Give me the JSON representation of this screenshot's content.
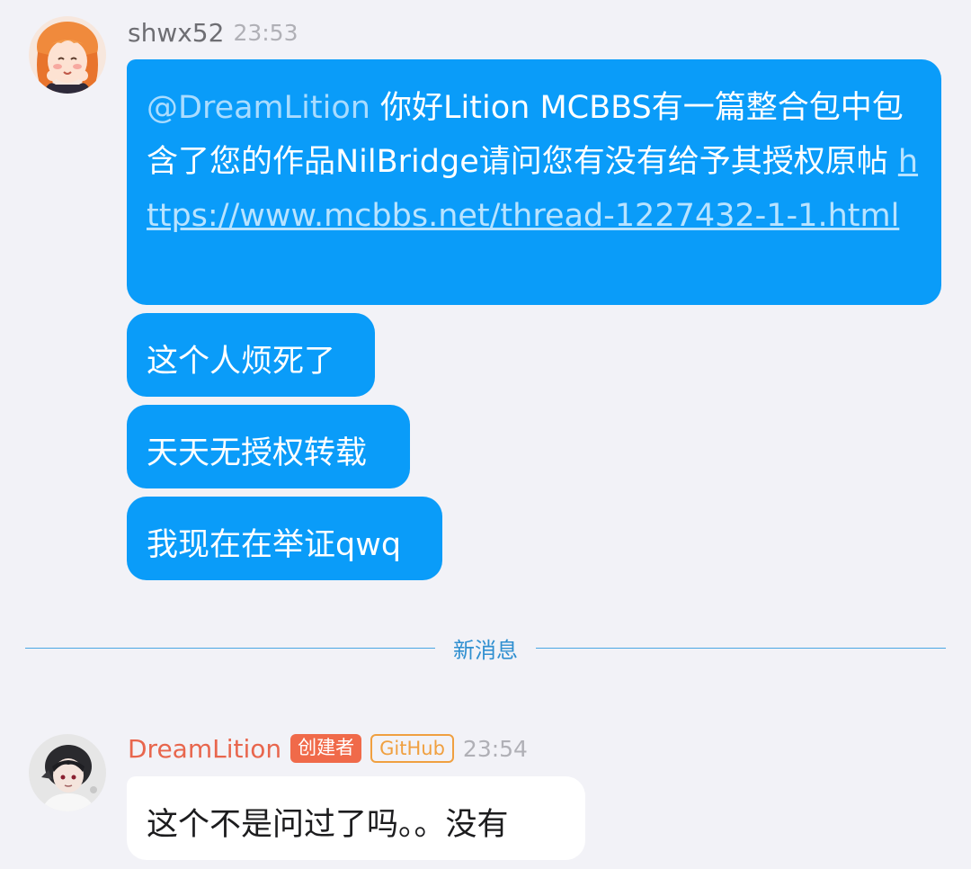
{
  "messages": [
    {
      "sender": "shwx52",
      "time": "23:53",
      "bubbles": [
        {
          "mention": "@DreamLition",
          "text": " 你好Lition MCBBS有一篇整合包中包含了您的作品NilBridge请问您有没有给予其授权原帖 ",
          "link": "https://www.mcbbs.net/thread-1227432-1-1.html"
        },
        {
          "text": "这个人烦死了"
        },
        {
          "text": "天天无授权转载"
        },
        {
          "text": "我现在在举证qwq"
        }
      ]
    },
    {
      "sender": "DreamLition",
      "time": "23:54",
      "badges": [
        "创建者",
        "GitHub"
      ],
      "bubbles": [
        {
          "text": "这个不是问过了吗。。没有"
        }
      ]
    }
  ],
  "divider": {
    "label": "新消息"
  },
  "colors": {
    "background": "#f2f2f7",
    "bubble_blue": "#0a9cf9",
    "creator_name": "#e8664d",
    "creator_badge": "#f06a4a",
    "github_badge": "#f0a040",
    "divider": "#4aa7e4"
  }
}
